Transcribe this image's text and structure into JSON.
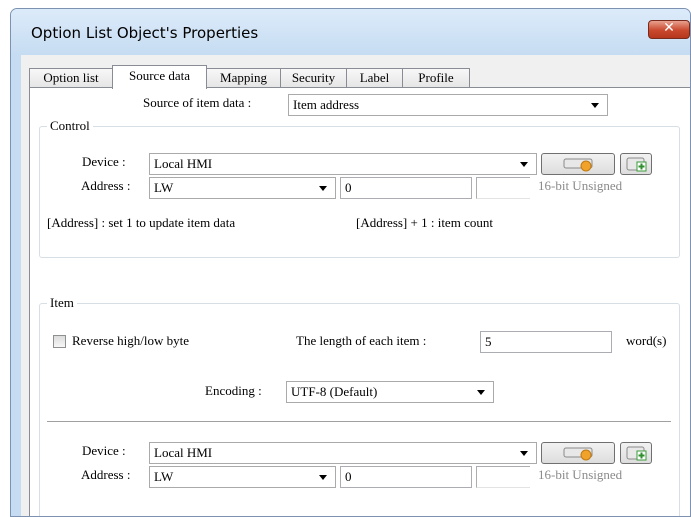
{
  "window": {
    "title": "Option List Object's Properties",
    "close_glyph": "✕"
  },
  "tabs": [
    "Option list",
    "Source data",
    "Mapping",
    "Security",
    "Label",
    "Profile"
  ],
  "active_tab": "Source data",
  "source": {
    "label": "Source of item data :",
    "value": "Item address"
  },
  "control": {
    "group_title": "Control",
    "device_label": "Device :",
    "device_value": "Local HMI",
    "address_label": "Address :",
    "address_type": "LW",
    "address_value": "0",
    "format_hint": "16-bit Unsigned",
    "note_left": "[Address] : set 1 to update item data",
    "note_right": "[Address]  + 1 : item count"
  },
  "item": {
    "group_title": "Item",
    "reverse_label": "Reverse high/low byte",
    "reverse_checked": false,
    "length_label": "The length of each item :",
    "length_value": "5",
    "length_unit": "word(s)",
    "encoding_label": "Encoding :",
    "encoding_value": "UTF-8 (Default)",
    "device_label": "Device :",
    "device_value": "Local HMI",
    "address_label": "Address :",
    "address_type": "LW",
    "address_value": "0",
    "format_hint": "16-bit Unsigned"
  },
  "icons": {
    "settings": "device-settings-icon",
    "add": "add-device-icon"
  }
}
